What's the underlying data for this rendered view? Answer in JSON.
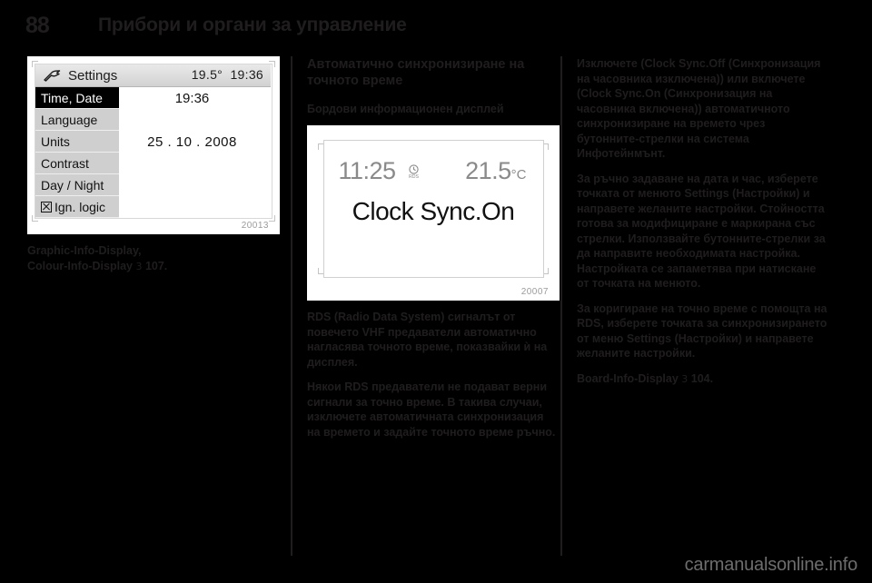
{
  "header": {
    "page_number": "88",
    "chapter_title": "Прибори и органи за управление"
  },
  "left_column": {
    "settings_display": {
      "figure_id": "20013",
      "titlebar": {
        "icon": "wrench-icon",
        "title": "Settings",
        "temperature": "19.5°",
        "clock": "19:36"
      },
      "menu_items": [
        {
          "label": "Time, Date",
          "selected": true,
          "icon": null
        },
        {
          "label": "Language",
          "selected": false,
          "icon": null
        },
        {
          "label": "Units",
          "selected": false,
          "icon": null
        },
        {
          "label": "Contrast",
          "selected": false,
          "icon": null
        },
        {
          "label": "Day / Night",
          "selected": false,
          "icon": null
        },
        {
          "label": "Ign. logic",
          "selected": false,
          "icon": "crossed-box-icon"
        }
      ],
      "content": {
        "time_value": "19:36",
        "date_value": "25 . 10 . 2008"
      }
    },
    "caption_line_1": "Graphic-Info-Display,",
    "caption_line_2": "Colour-Info-Display",
    "caption_ref_arrow": "3",
    "caption_ref_page": "107."
  },
  "mid_column": {
    "heading": "Автоматично синхронизиране на точното време",
    "subheading": "Бордови информационен дисплей",
    "board_display": {
      "figure_id": "20007",
      "time": "11:25",
      "rds_icon": "clock-rds-icon",
      "temperature": "21.5",
      "temperature_unit": "°C",
      "message": "Clock Sync.On"
    },
    "paragraphs": [
      "RDS (Radio Data System) сигналът от повечето VHF предаватели автоматично нагласява точното време, показвайки ѝ на дисплея.",
      "Някои RDS предаватели не подават верни сигнали за точно време. В такива случаи, изключете автоматичната синхронизация на времето и задайте точното време ръчно."
    ]
  },
  "right_column": {
    "paragraphs": [
      "Изключете (Clock Sync.Off (Синхронизация на часовника изключена)) или включете (Clock Sync.On (Синхронизация на часовника включена)) автоматичното синхронизиране на времето чрез бутонните-стрелки на система Инфотейнмънт.",
      "За ръчно задаване на дата и час, изберете точката от менюто Settings (Настройки) и направете желаните настройки. Стойността готова за модифициране е маркирана със стрелки. Използвайте бутонните-стрелки за да направите необходимата настройка. Настройката се запаметява при натискане от точката на менюто.",
      "За коригиране на точно време с помощта на RDS, изберете точката за синхронизирането от меню Settings (Настройки) и направете желаните настройки."
    ],
    "reference": {
      "label": "Board-Info-Display",
      "arrow": "3",
      "page": "104."
    }
  },
  "watermark": "carmanualsonline.info"
}
